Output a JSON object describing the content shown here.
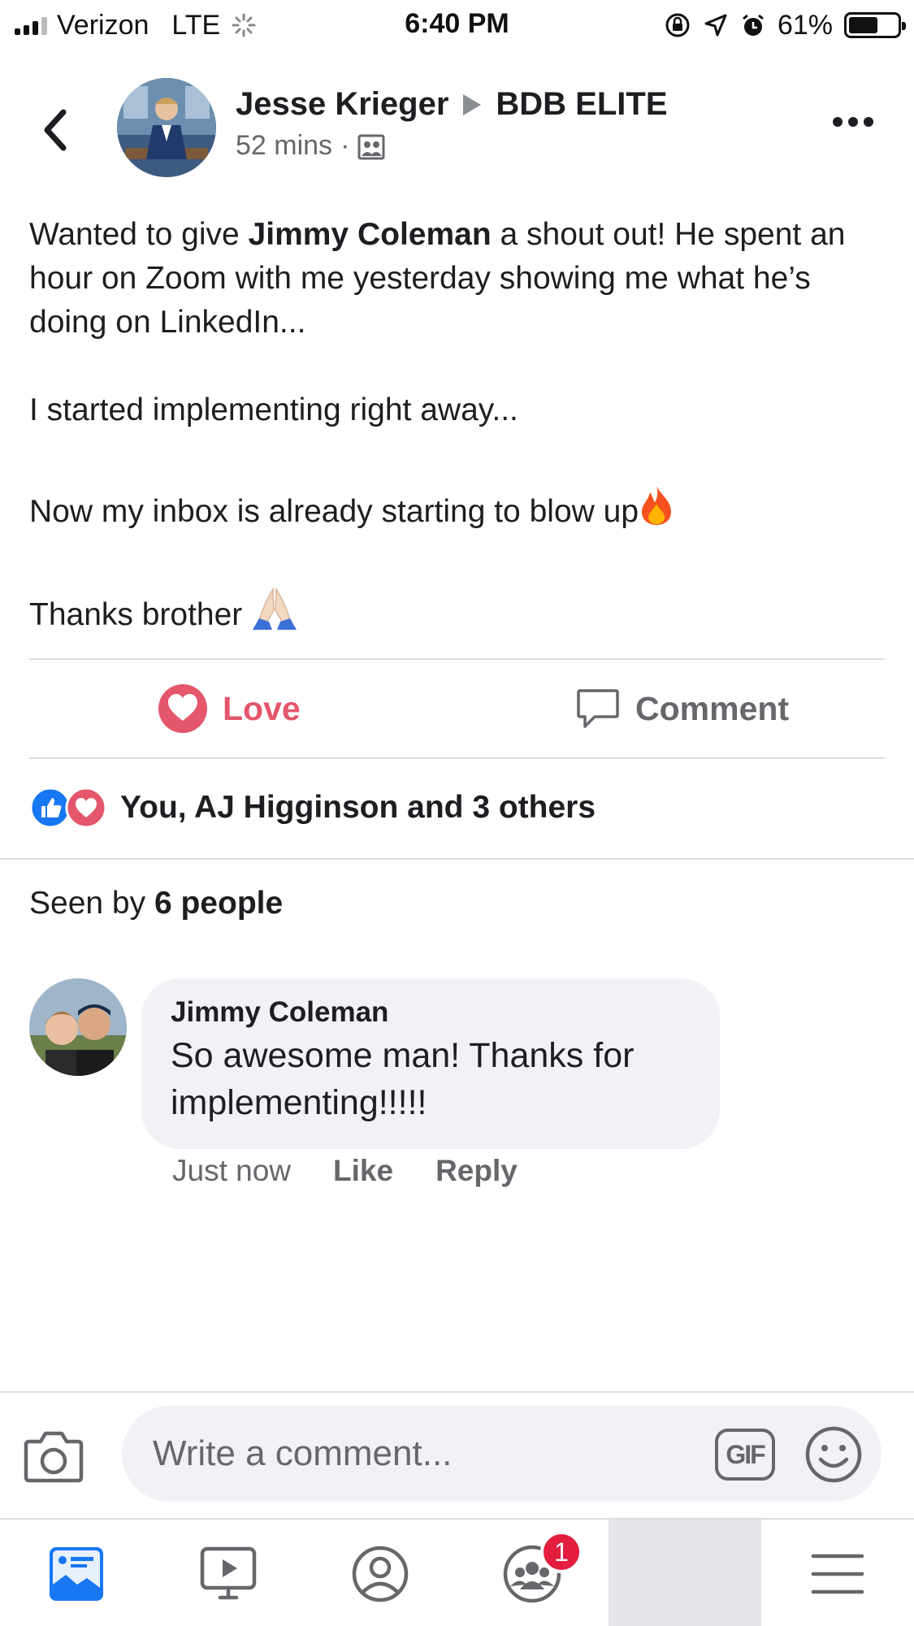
{
  "status_bar": {
    "carrier": "Verizon",
    "network": "LTE",
    "time": "6:40 PM",
    "battery": "61%"
  },
  "post": {
    "author": "Jesse Krieger",
    "group": "BDB ELITE",
    "time": "52 mins",
    "body": {
      "line1_pre": "Wanted to give ",
      "mention": "Jimmy Coleman",
      "line1_post": " a shout out! He spent an hour on Zoom with me yesterday showing me what he’s doing on LinkedIn...",
      "para2": "I started implementing right away...",
      "para3": "Now my inbox is already starting to blow up",
      "para4": "Thanks brother "
    }
  },
  "actions": {
    "love_label": "Love",
    "comment_label": "Comment"
  },
  "reactions": {
    "summary": "You, AJ Higginson and 3 others"
  },
  "seen": {
    "prefix": "Seen by ",
    "count": "6 people"
  },
  "comment": {
    "author": "Jimmy Coleman",
    "text": "So awesome man! Thanks for implementing!!!!!",
    "time": "Just now",
    "like_label": "Like",
    "reply_label": "Reply"
  },
  "composer": {
    "placeholder": "Write a comment...",
    "gif_label": "GIF"
  },
  "tab_bar": {
    "groups_badge": "1",
    "items": [
      "news-feed",
      "watch",
      "profile",
      "groups",
      "blank",
      "menu"
    ]
  },
  "colors": {
    "love": "#e4566b",
    "like_blue": "#1877f2",
    "secondary_text": "#65676b",
    "badge": "#e41e3f"
  }
}
